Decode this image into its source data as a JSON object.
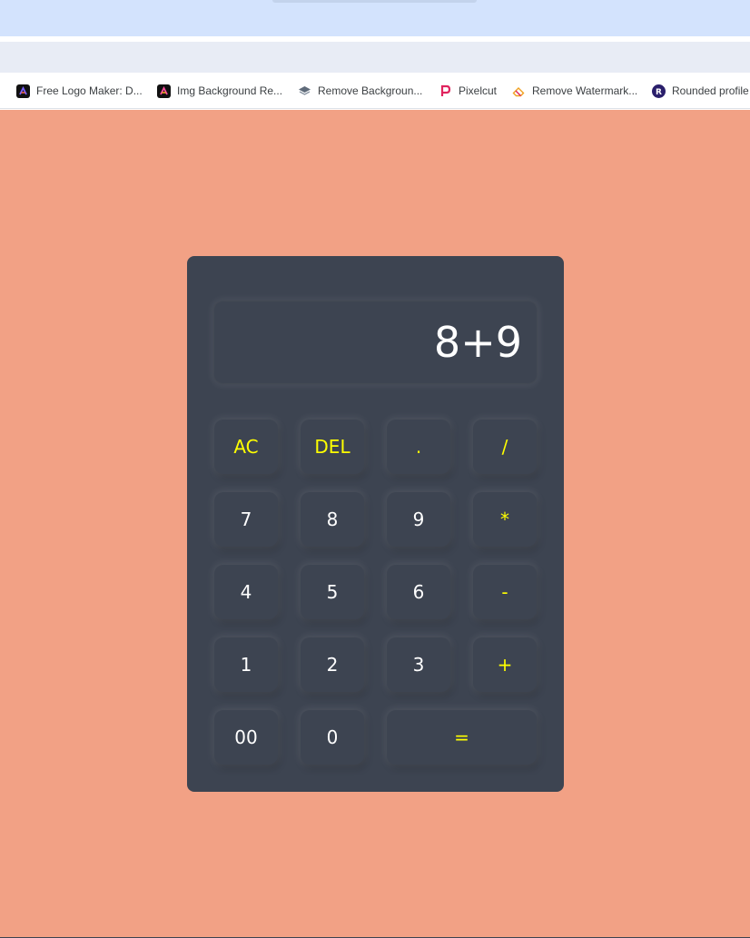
{
  "bookmarks": [
    {
      "label": "Free Logo Maker: D...",
      "icon": "logo-maker-icon"
    },
    {
      "label": "Img Background Re...",
      "icon": "img-background-icon"
    },
    {
      "label": "Remove Backgroun...",
      "icon": "layers-icon"
    },
    {
      "label": "Pixelcut",
      "icon": "pixelcut-icon"
    },
    {
      "label": "Remove Watermark...",
      "icon": "eraser-icon"
    },
    {
      "label": "Rounded profile",
      "icon": "rounded-profile-icon"
    }
  ],
  "calculator": {
    "display": "8+9",
    "keys": {
      "ac": "AC",
      "del": "DEL",
      "dot": ".",
      "divide": "/",
      "seven": "7",
      "eight": "8",
      "nine": "9",
      "multiply": "*",
      "four": "4",
      "five": "5",
      "six": "6",
      "minus": "-",
      "one": "1",
      "two": "2",
      "three": "3",
      "plus": "+",
      "double_zero": "00",
      "zero": "0",
      "equals": "="
    }
  },
  "colors": {
    "page_background": "#f2a185",
    "calculator_body": "#3d4451",
    "operator_text": "#ffff00",
    "number_text": "#ffffff"
  }
}
